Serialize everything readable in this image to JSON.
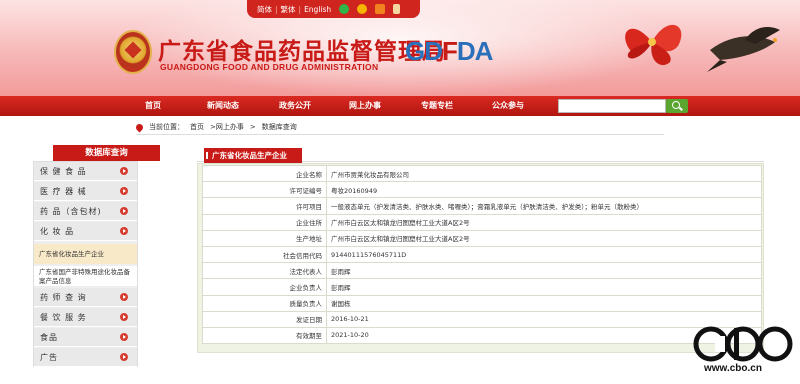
{
  "header": {
    "lang": {
      "simplified": "简体",
      "traditional": "繁体",
      "english": "English",
      "sep": "|"
    },
    "title": "广东省食品药品监督管理局",
    "subtitle": "GUANGDONG FOOD AND DRUG ADMINISTRATION",
    "logo_text": {
      "a": "GD",
      "b": "F",
      "c": "DA"
    }
  },
  "nav": {
    "items": [
      "首页",
      "新闻动态",
      "政务公开",
      "网上办事",
      "专题专栏",
      "公众参与"
    ],
    "search_placeholder": ""
  },
  "breadcrumb": [
    "当前位置：",
    "首页",
    ">网上办事",
    ">",
    "数据库查询"
  ],
  "sidebar": {
    "heading": "数据库查询",
    "items": [
      {
        "label": "保 健 食 品"
      },
      {
        "label": "医 疗 器 械"
      },
      {
        "label": "药 品（含包材)"
      },
      {
        "label": "化 妆 品"
      }
    ],
    "sub_items": [
      {
        "label": "广东省化妆品生产企业"
      },
      {
        "label": "广东省国产非特殊用途化妆品备案产品信息"
      }
    ],
    "items2": [
      {
        "label": "药 师 查 询"
      },
      {
        "label": "餐 饮 服 务"
      },
      {
        "label": "食品"
      },
      {
        "label": "广告"
      }
    ]
  },
  "panel": {
    "title": "广东省化妆品生产企业",
    "rows": [
      {
        "key": "企业名称",
        "value": "广州市贾莱化妆品有限公司"
      },
      {
        "key": "许可证编号",
        "value": "粤妆20160949"
      },
      {
        "key": "许可项目",
        "value": "一般液态单元（护发清洁类、护肤水类、啫喱类）；膏霜乳液单元（护肤清洁类、护发类）；粉单元（散粉类）"
      },
      {
        "key": "企业住所",
        "value": "广州市白云区太和镇龙归图窟村工业大道A区2号"
      },
      {
        "key": "生产地址",
        "value": "广州市白云区太和镇龙归图窟村工业大道A区2号"
      },
      {
        "key": "社会信用代码",
        "value": "91440111576045711D"
      },
      {
        "key": "法定代表人",
        "value": "彭雨辉"
      },
      {
        "key": "企业负责人",
        "value": "彭雨辉"
      },
      {
        "key": "质量负责人",
        "value": "谢国栋"
      },
      {
        "key": "发证日期",
        "value": "2016-10-21"
      },
      {
        "key": "有效期至",
        "value": "2021-10-20"
      }
    ]
  },
  "watermark": {
    "logo": "CBO",
    "url": "www.cbo.cn"
  },
  "colors": {
    "brand_red": "#c81a16",
    "nav_red": "#d92a22",
    "panel_bg": "#eef3e4",
    "search_green": "#5aa62f"
  },
  "icons": [
    "wechat-icon",
    "weibo-icon",
    "rss-icon",
    "mobile-icon",
    "search-icon",
    "pin-icon",
    "arrow-right-icon"
  ]
}
